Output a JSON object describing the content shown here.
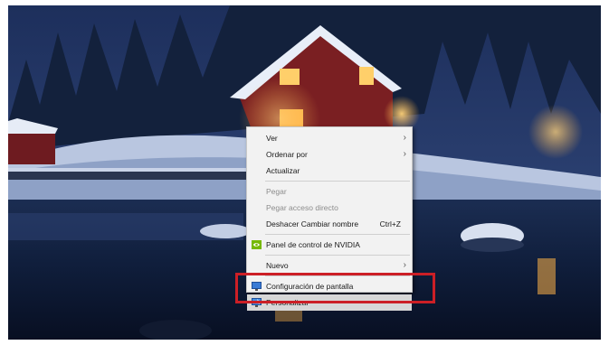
{
  "desktop": {
    "wallpaper": "snowy-lakeside-cabin-night"
  },
  "context_menu": {
    "items": [
      {
        "label": "Ver",
        "submenu": true
      },
      {
        "label": "Ordenar por",
        "submenu": true
      },
      {
        "label": "Actualizar"
      },
      {
        "label": "Pegar",
        "disabled": true
      },
      {
        "label": "Pegar acceso directo",
        "disabled": true
      },
      {
        "label": "Deshacer Cambiar nombre",
        "shortcut": "Ctrl+Z"
      },
      {
        "label": "Panel de control de NVIDIA",
        "icon": "nvidia-icon"
      },
      {
        "label": "Nuevo",
        "submenu": true
      },
      {
        "label": "Configuración de pantalla",
        "icon": "display-settings-icon"
      },
      {
        "label": "Personalizar",
        "icon": "personalize-icon",
        "highlighted": true
      }
    ],
    "submenu_arrow": "›"
  },
  "colors": {
    "highlight_box": "#cc1f26",
    "menu_bg": "#f2f2f2"
  }
}
